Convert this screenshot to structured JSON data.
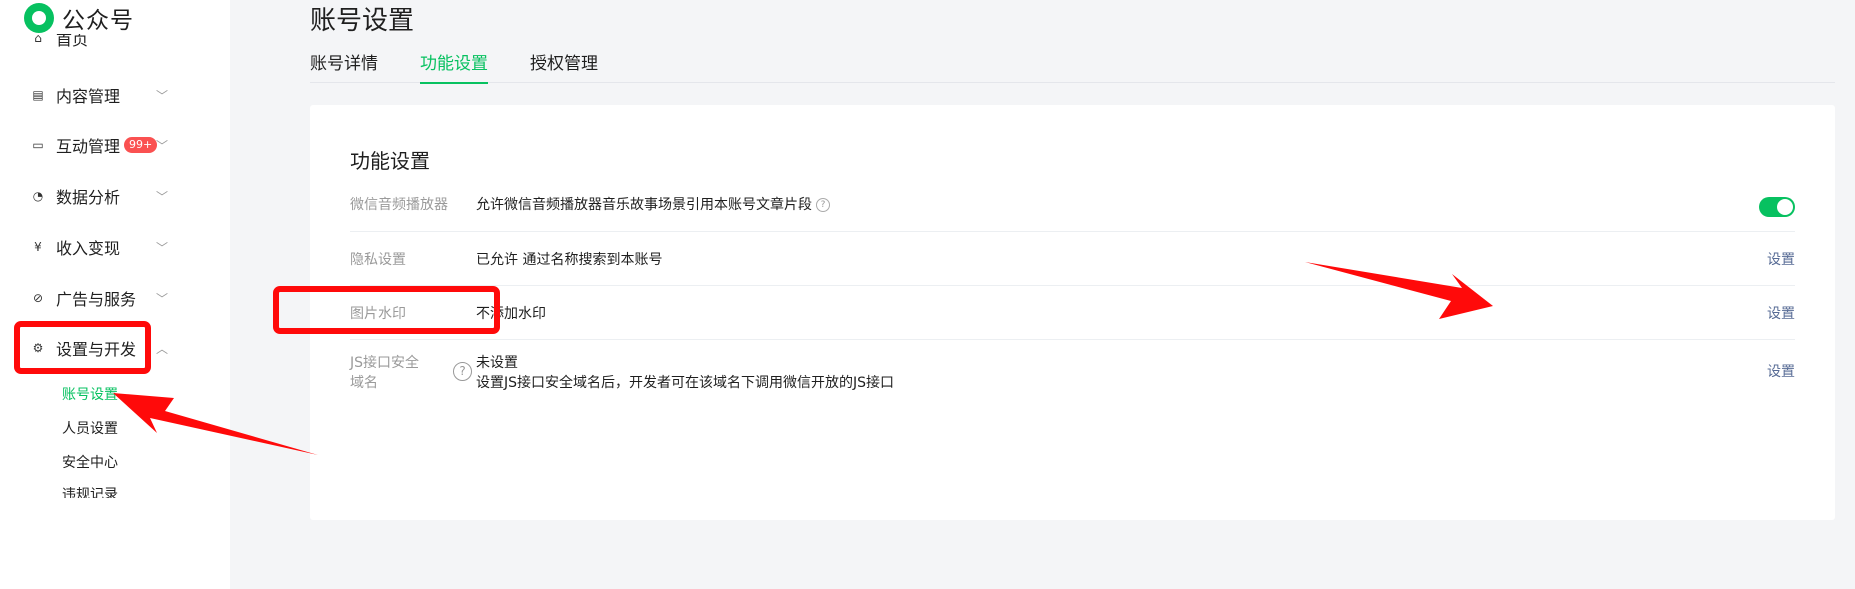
{
  "app": {
    "logo_text": "公众号"
  },
  "sidebar": {
    "partial_item": "首页",
    "items": [
      {
        "label": "内容管理",
        "icon": "document-icon"
      },
      {
        "label": "互动管理",
        "icon": "comment-icon",
        "badge": "99+"
      },
      {
        "label": "数据分析",
        "icon": "pie-chart-icon"
      },
      {
        "label": "收入变现",
        "icon": "yen-icon"
      },
      {
        "label": "广告与服务",
        "icon": "compass-icon"
      },
      {
        "label": "设置与开发",
        "icon": "gear-icon"
      }
    ],
    "sub_items": [
      "账号设置",
      "人员设置",
      "安全中心",
      "违规记录"
    ]
  },
  "page": {
    "title": "账号设置",
    "tabs": [
      "账号详情",
      "功能设置",
      "授权管理"
    ],
    "active_tab": "功能设置"
  },
  "card": {
    "title": "功能设置",
    "rows": [
      {
        "label": "微信音频播放器",
        "value": "允许微信音频播放器音乐故事场景引用本账号文章片段",
        "help_icon": "?",
        "toggle_on": true
      },
      {
        "label": "隐私设置",
        "value": "已允许 通过名称搜索到本账号",
        "action": "设置"
      },
      {
        "label": "图片水印",
        "value": "不添加水印",
        "action": "设置"
      },
      {
        "label": "JS接口安全域名",
        "help_icon": "?",
        "value": "未设置",
        "value2": "设置JS接口安全域名后，开发者可在该域名下调用微信开放的JS接口",
        "action": "设置"
      }
    ]
  },
  "colors": {
    "accent": "#07c160",
    "link": "#576b95",
    "badge": "#fa5151",
    "annotation": "#ff0a0a"
  }
}
